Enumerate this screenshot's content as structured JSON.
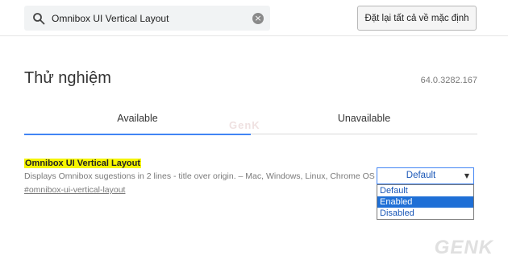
{
  "search": {
    "value": "Omnibox UI Vertical Layout"
  },
  "header": {
    "reset_label": "Đặt lại tất cả về mặc định"
  },
  "page": {
    "title": "Thử nghiệm",
    "version": "64.0.3282.167"
  },
  "tabs": [
    {
      "label": "Available",
      "active": true
    },
    {
      "label": "Unavailable",
      "active": false
    }
  ],
  "experiment": {
    "title": "Omnibox UI Vertical Layout",
    "description": "Displays Omnibox sugestions in 2 lines - title over origin. – Mac, Windows, Linux, Chrome OS",
    "link": "#omnibox-ui-vertical-layout",
    "selected_value": "Default",
    "options": [
      "Default",
      "Enabled",
      "Disabled"
    ],
    "highlighted_option": "Enabled"
  },
  "watermark": {
    "mid_text": "GenK",
    "logo_text": "GENK"
  },
  "colors": {
    "accent": "#4285f4",
    "highlight_yellow": "#f5f500",
    "option_selected_bg": "#1e6fd6",
    "option_text": "#1a57b7"
  }
}
